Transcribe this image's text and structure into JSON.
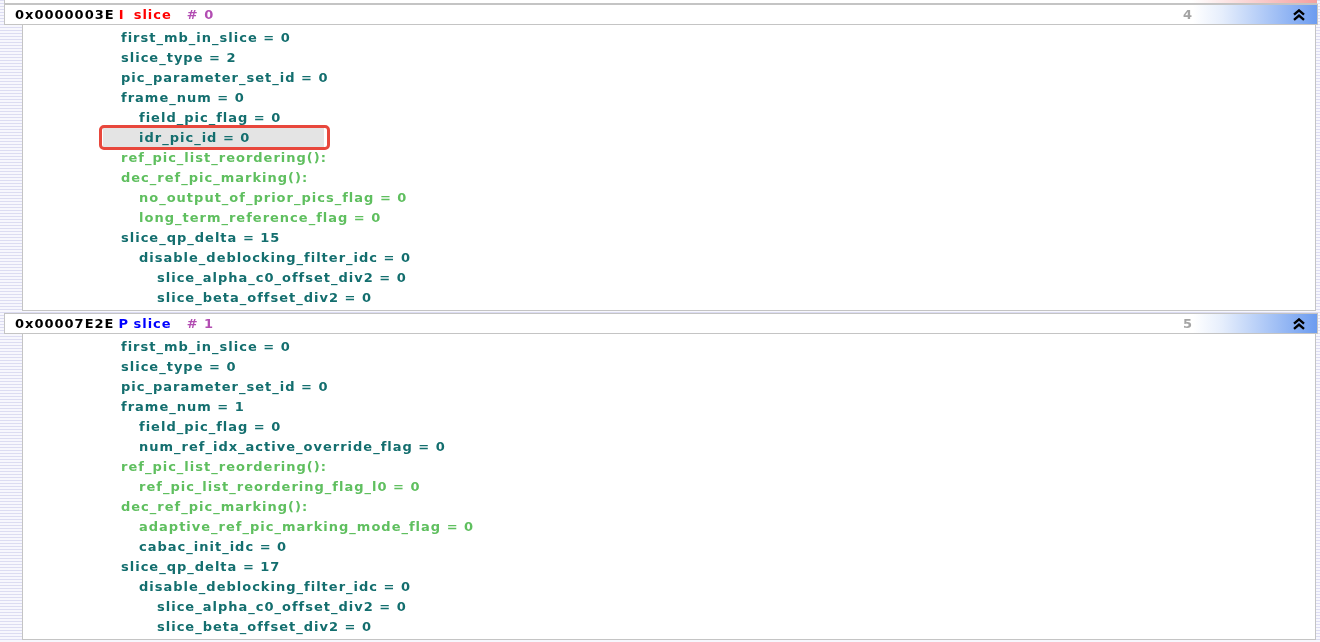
{
  "slices": [
    {
      "address": "0x0000003E",
      "type": "I",
      "type_label": "slice",
      "color": "#ff0000",
      "index": "# 0",
      "number": "4",
      "expanded": true,
      "lines": [
        {
          "text": "first_mb_in_slice = 0",
          "kind": "field",
          "selected": false,
          "annotated": false
        },
        {
          "text": "slice_type = 2",
          "kind": "field",
          "selected": false,
          "annotated": false
        },
        {
          "text": "pic_parameter_set_id = 0",
          "kind": "field",
          "selected": false,
          "annotated": false
        },
        {
          "text": "frame_num = 0",
          "kind": "field",
          "selected": false,
          "annotated": false,
          "children": [
            {
              "text": "field_pic_flag = 0",
              "kind": "field",
              "selected": false,
              "annotated": false
            },
            {
              "text": "idr_pic_id = 0",
              "kind": "field",
              "selected": true,
              "annotated": true
            }
          ]
        },
        {
          "text": "ref_pic_list_reordering():",
          "kind": "ref",
          "selected": false,
          "annotated": false
        },
        {
          "text": "dec_ref_pic_marking():",
          "kind": "ref",
          "selected": false,
          "annotated": false,
          "children": [
            {
              "text": "no_output_of_prior_pics_flag = 0",
              "kind": "ref",
              "selected": false,
              "annotated": false
            },
            {
              "text": "long_term_reference_flag = 0",
              "kind": "ref",
              "selected": false,
              "annotated": false
            }
          ]
        },
        {
          "text": "slice_qp_delta = 15",
          "kind": "field",
          "selected": false,
          "annotated": false,
          "children": [
            {
              "text": "disable_deblocking_filter_idc = 0",
              "kind": "field",
              "selected": false,
              "annotated": false,
              "children": [
                {
                  "text": "slice_alpha_c0_offset_div2 = 0",
                  "kind": "field",
                  "selected": false,
                  "annotated": false
                },
                {
                  "text": "slice_beta_offset_div2 = 0",
                  "kind": "field",
                  "selected": false,
                  "annotated": false
                }
              ]
            }
          ]
        }
      ]
    },
    {
      "address": "0x00007E2E",
      "type": "P",
      "type_label": "slice",
      "color": "#0000ff",
      "index": "# 1",
      "number": "5",
      "expanded": true,
      "lines": [
        {
          "text": "first_mb_in_slice = 0",
          "kind": "field",
          "selected": false,
          "annotated": false
        },
        {
          "text": "slice_type = 0",
          "kind": "field",
          "selected": false,
          "annotated": false
        },
        {
          "text": "pic_parameter_set_id = 0",
          "kind": "field",
          "selected": false,
          "annotated": false
        },
        {
          "text": "frame_num = 1",
          "kind": "field",
          "selected": false,
          "annotated": false,
          "children": [
            {
              "text": "field_pic_flag = 0",
              "kind": "field",
              "selected": false,
              "annotated": false
            },
            {
              "text": "num_ref_idx_active_override_flag = 0",
              "kind": "field",
              "selected": false,
              "annotated": false
            }
          ]
        },
        {
          "text": "ref_pic_list_reordering():",
          "kind": "ref",
          "selected": false,
          "annotated": false,
          "children": [
            {
              "text": "ref_pic_list_reordering_flag_l0 = 0",
              "kind": "ref",
              "selected": false,
              "annotated": false
            }
          ]
        },
        {
          "text": "dec_ref_pic_marking():",
          "kind": "ref",
          "selected": false,
          "annotated": false,
          "children": [
            {
              "text": "adaptive_ref_pic_marking_mode_flag = 0",
              "kind": "ref",
              "selected": false,
              "annotated": false
            },
            {
              "text": "cabac_init_idc = 0",
              "kind": "field",
              "selected": false,
              "annotated": false
            }
          ]
        },
        {
          "text": "slice_qp_delta = 17",
          "kind": "field",
          "selected": false,
          "annotated": false,
          "children": [
            {
              "text": "disable_deblocking_filter_idc = 0",
              "kind": "field",
              "selected": false,
              "annotated": false,
              "children": [
                {
                  "text": "slice_alpha_c0_offset_div2 = 0",
                  "kind": "field",
                  "selected": false,
                  "annotated": false
                },
                {
                  "text": "slice_beta_offset_div2 = 0",
                  "kind": "field",
                  "selected": false,
                  "annotated": false
                }
              ]
            }
          ]
        }
      ]
    }
  ]
}
